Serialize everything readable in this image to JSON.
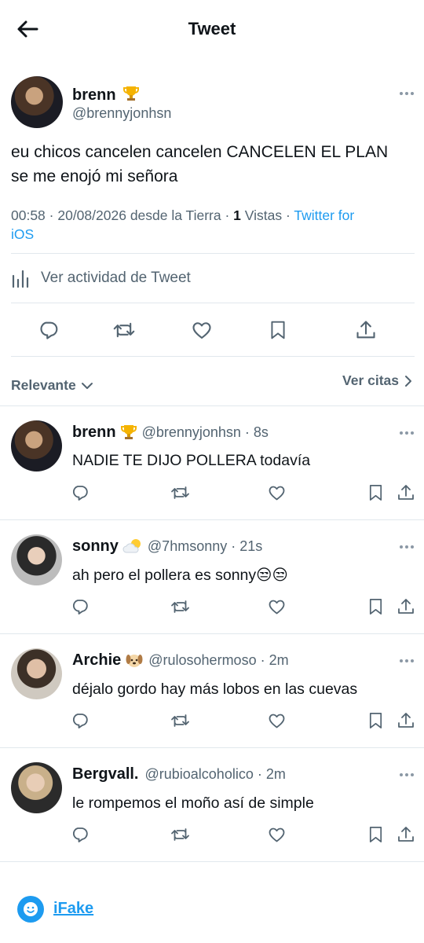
{
  "header": {
    "title": "Tweet"
  },
  "tweet": {
    "display_name": "brenn",
    "name_emoji": "trophy",
    "handle": "@brennyjonhsn",
    "text_line1": "eu chicos cancelen cancelen CANCELEN EL PLAN",
    "text_line2": "se me enojó mi señora",
    "time": "00:58",
    "date": "20/08/2026",
    "location": "desde la Tierra",
    "views_count": "1",
    "views_label": "Vistas",
    "source_line1": "Twitter for",
    "source_line2": "iOS",
    "activity_label": "Ver actividad de Tweet"
  },
  "sort": {
    "relevante_label": "Relevante",
    "citas_label": "Ver citas"
  },
  "replies": [
    {
      "name": "brenn",
      "emoji": "trophy",
      "handle": "@brennyjonhsn",
      "time": "8s",
      "text": "NADIE TE DIJO POLLERA todavía"
    },
    {
      "name": "sonny",
      "emoji": "sun-behind-cloud",
      "handle": "@7hmsonny",
      "time": "21s",
      "text": "ah pero el pollera es sonny😒😒"
    },
    {
      "name": "Archie",
      "emoji": "dog-face",
      "handle": "@rulosohermoso",
      "time": "2m",
      "text": "déjalo gordo hay más lobos en las cuevas"
    },
    {
      "name": "Bergvall.",
      "emoji": "",
      "handle": "@rubioalcoholico",
      "time": "2m",
      "text": "le rompemos el moño así de simple"
    }
  ],
  "footer": {
    "brand": "iFake"
  },
  "colors": {
    "accent": "#1d9bf0",
    "secondary_text": "#536471",
    "primary_text": "#0f1419",
    "divider": "#e1e8ed"
  },
  "icons": [
    "back-arrow-icon",
    "more-icon",
    "trophy-icon",
    "sun-behind-cloud-icon",
    "dog-face-icon",
    "bar-chart-icon",
    "reply-icon",
    "retweet-icon",
    "like-icon",
    "bookmark-icon",
    "share-icon",
    "chevron-down-icon",
    "chevron-right-icon",
    "ifake-logo-icon"
  ]
}
